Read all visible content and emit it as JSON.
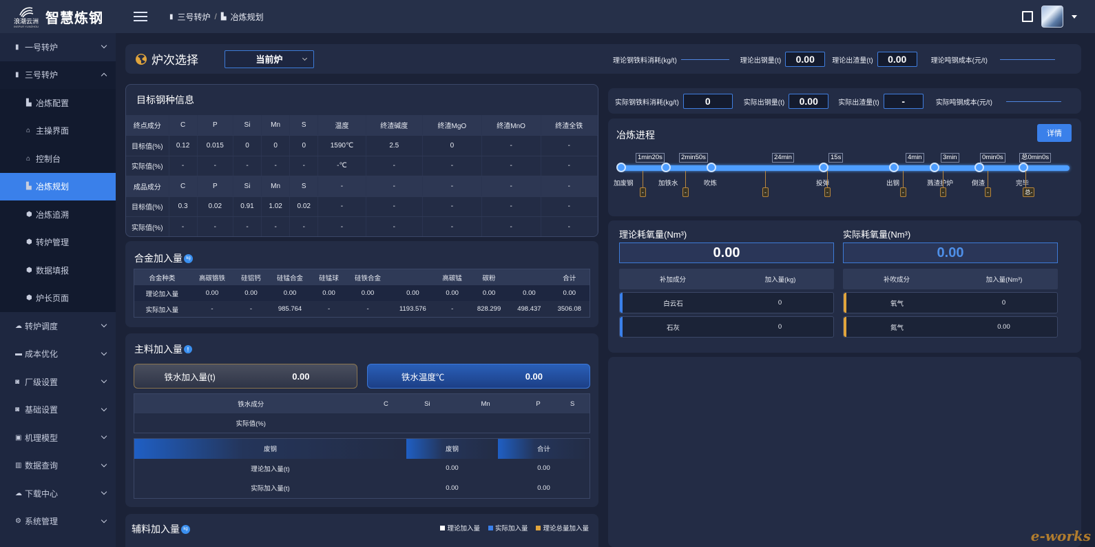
{
  "app": {
    "logo_cn": "浪潮云洲",
    "logo_en": "INSPUR YUNZHOU",
    "title": "智慧炼钢"
  },
  "breadcrumb": [
    "三号转炉",
    "/",
    "冶炼规划"
  ],
  "sidebar": {
    "items": [
      {
        "label": "一号转炉",
        "icon": "furnace-icon"
      },
      {
        "label": "三号转炉",
        "icon": "furnace-icon"
      },
      {
        "label": "冶炼配置",
        "icon": "config-icon"
      },
      {
        "label": "主操界面",
        "icon": "home-icon"
      },
      {
        "label": "控制台",
        "icon": "home-icon"
      },
      {
        "label": "冶炼规划",
        "icon": "plan-icon"
      },
      {
        "label": "冶炼追溯",
        "icon": "trace-icon"
      },
      {
        "label": "转炉管理",
        "icon": "manage-icon"
      },
      {
        "label": "数据填报",
        "icon": "report-icon"
      },
      {
        "label": "炉长页面",
        "icon": "user-icon"
      },
      {
        "label": "转炉调度",
        "icon": "cloud-icon"
      },
      {
        "label": "成本优化",
        "icon": "briefcase-icon"
      },
      {
        "label": "厂级设置",
        "icon": "camera-icon"
      },
      {
        "label": "基础设置",
        "icon": "camera-icon"
      },
      {
        "label": "机理模型",
        "icon": "model-icon"
      },
      {
        "label": "数据查询",
        "icon": "chart-icon"
      },
      {
        "label": "下载中心",
        "icon": "cloud-icon"
      },
      {
        "label": "系统管理",
        "icon": "gear-icon"
      }
    ]
  },
  "furnace": {
    "title": "炉次选择",
    "select_value": "当前炉",
    "metrics": [
      {
        "label": "理论钢铁料消耗(kg/t)",
        "value": null
      },
      {
        "label": "理论出钢量(t)",
        "value": "0.00"
      },
      {
        "label": "理论出渣量(t)",
        "value": "0.00"
      },
      {
        "label": "理论吨钢成本(元/t)",
        "value": null
      }
    ]
  },
  "actual": {
    "metrics": [
      {
        "label": "实际钢铁料消耗(kg/t)",
        "value": "0"
      },
      {
        "label": "实际出钢量(t)",
        "value": "0.00"
      },
      {
        "label": "实际出渣量(t)",
        "value": "-"
      },
      {
        "label": "实际吨钢成本(元/t)",
        "value": null
      }
    ]
  },
  "target": {
    "title": "目标钢种信息",
    "rows": [
      [
        "终点成分",
        "C",
        "P",
        "Si",
        "Mn",
        "S",
        "温度",
        "终渣碱度",
        "终渣MgO",
        "终渣MnO",
        "终渣全铁"
      ],
      [
        "目标值(%)",
        "0.12",
        "0.015",
        "0",
        "0",
        "0",
        "1590℃",
        "2.5",
        "0",
        "-",
        "-"
      ],
      [
        "实际值(%)",
        "-",
        "-",
        "-",
        "-",
        "-",
        "-℃",
        "-",
        "-",
        "-",
        "-"
      ],
      [
        "成品成分",
        "C",
        "P",
        "Si",
        "Mn",
        "S",
        "-",
        "-",
        "-",
        "-",
        "-"
      ],
      [
        "目标值(%)",
        "0.3",
        "0.02",
        "0.91",
        "1.02",
        "0.02",
        "-",
        "-",
        "-",
        "-",
        "-"
      ],
      [
        "实际值(%)",
        "-",
        "-",
        "-",
        "-",
        "-",
        "-",
        "-",
        "-",
        "-",
        "-"
      ]
    ]
  },
  "alloy": {
    "title": "合金加入量",
    "unit": "kg",
    "rows": [
      [
        "合金种类",
        "高碳铬铁",
        "硅铝钙",
        "硅锰合金",
        "硅锰球",
        "硅铁合金",
        "",
        "高碳锰",
        "碳粉",
        "",
        "合计"
      ],
      [
        "理论加入量",
        "0.00",
        "0.00",
        "0.00",
        "0.00",
        "0.00",
        "0.00",
        "0.00",
        "0.00",
        "0.00",
        "0.00"
      ],
      [
        "实际加入量",
        "-",
        "-",
        "985.764",
        "-",
        "-",
        "1193.576",
        "-",
        "828.299",
        "498.437",
        "3506.08"
      ]
    ]
  },
  "main_material": {
    "title": "主料加入量",
    "info": "!",
    "iron_label": "铁水加入量(t)",
    "iron_value": "0.00",
    "temp_label": "铁水温度℃",
    "temp_value": "0.00",
    "iron_rows": [
      [
        "铁水成分",
        "C",
        "Si",
        "Mn",
        "P",
        "S"
      ],
      [
        "实际值(%)",
        "",
        "",
        "",
        "",
        ""
      ]
    ],
    "scrap_rows": [
      [
        "废钢",
        "废钢",
        "合计"
      ],
      [
        "理论加入量(t)",
        "0.00",
        "0.00"
      ],
      [
        "实际加入量(t)",
        "0.00",
        "0.00"
      ]
    ]
  },
  "aux": {
    "title": "辅料加入量",
    "unit": "kg",
    "legend": [
      {
        "label": "理论加入量",
        "color": "#ffffff"
      },
      {
        "label": "实际加入量",
        "color": "#3a80ea"
      },
      {
        "label": "理论总量加入量",
        "color": "#e0a43c"
      }
    ]
  },
  "progress": {
    "title": "冶炼进程",
    "detail_label": "详情",
    "durations": [
      "1min20s",
      "2min50s",
      "24min",
      "15s",
      "4min",
      "3min",
      "0min0s",
      "总0min0s"
    ],
    "stages": [
      "加废钢",
      "加铁水",
      "吹炼",
      "投弹",
      "出钢",
      "溅渣护炉",
      "倒渣",
      "完毕"
    ],
    "pills": [
      "-",
      "-",
      "-",
      "-",
      "-",
      "-",
      "-",
      "总-"
    ]
  },
  "oxygen": {
    "theory_title": "理论耗氧量(Nm³)",
    "theory_value": "0.00",
    "actual_title": "实际耗氧量(Nm³)",
    "actual_value": "0.00",
    "left_head": [
      "补加成分",
      "加入量(kg)"
    ],
    "left_rows": [
      [
        "白云石",
        "0"
      ],
      [
        "石灰",
        "0"
      ]
    ],
    "right_head": [
      "补吹成分",
      "加入量(Nm³)"
    ],
    "right_rows": [
      [
        "氧气",
        "0"
      ],
      [
        "氮气",
        "0.00"
      ]
    ]
  },
  "watermark": "e-works",
  "colors": {
    "accent": "#3a80ea",
    "panel": "#232c45",
    "bg": "#1b2237",
    "gold": "#e0a43c"
  }
}
